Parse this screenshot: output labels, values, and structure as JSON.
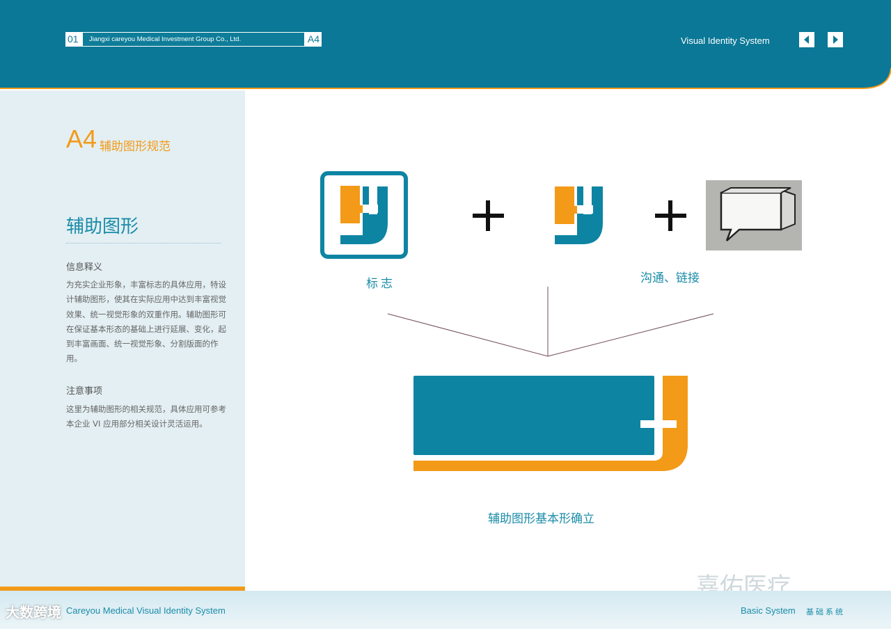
{
  "colors": {
    "header_teal": "#0a7896",
    "accent_orange": "#f39a18",
    "teal_text": "#1a8ca8",
    "sidebar_bg": "#e3eff3"
  },
  "header": {
    "page_number": "01",
    "company": "Jiangxi careyou Medical Investment Group Co., Ltd.",
    "section_code": "A4",
    "system_title": "Visual Identity System",
    "prev_icon": "triangle-left-icon",
    "next_icon": "triangle-right-icon"
  },
  "sidebar": {
    "section_code": "A4",
    "section_title": "辅助图形规范",
    "heading": "辅助图形",
    "subheading1": "信息释义",
    "paragraph1": "为充实企业形象，丰富标志的具体应用，特设计辅助图形，使其在实际应用中达到丰富视觉效果、统一视觉形象的双重作用。辅助图形可在保证基本形态的基础上进行延展、变化，起到丰富画面、统一视觉形象、分割版面的作用。",
    "subheading2": "注意事项",
    "paragraph2": "这里为辅助图形的相关规范，具体应用可参考本企业 VI 应用部分相关设计灵活运用。"
  },
  "main": {
    "label_logo": "标志",
    "label_communication": "沟通、链接",
    "label_base_shape": "辅助图形基本形确立",
    "plus_sign": "+"
  },
  "watermark": "嘉佑医疗",
  "footer": {
    "left_text": "Careyou Medical Visual Identity System",
    "brand_overlay": "大数跨境",
    "right_text": "Basic System",
    "right_cn": "基础系统"
  }
}
